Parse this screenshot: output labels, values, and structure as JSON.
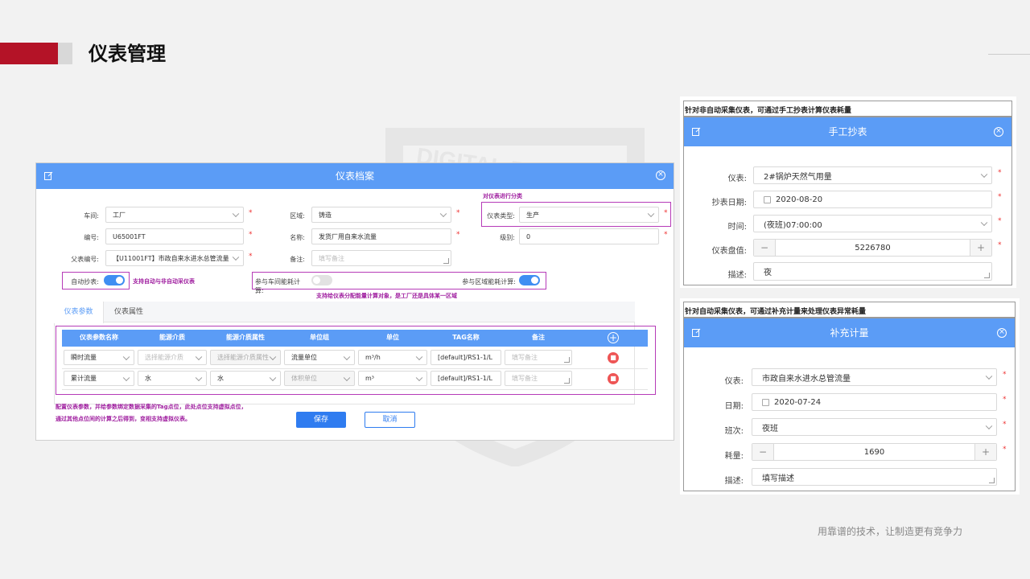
{
  "page": {
    "title": "仪表管理",
    "footer": "用靠谱的技术，让制造更有竞争力"
  },
  "watermark": {
    "text": "DIGITAL FACTORY"
  },
  "colors": {
    "accent": "#5b9cf6",
    "brand_red": "#b41327",
    "annotation": "#a020a0"
  },
  "meter_dialog": {
    "title": "仪表档案",
    "annotation_classify": "对仪表进行分类",
    "fields": {
      "workshop_label": "车间:",
      "workshop_value": "工厂",
      "area_label": "区域:",
      "area_value": "铸造",
      "type_label": "仪表类型:",
      "type_value": "生产",
      "code_label": "编号:",
      "code_value": "U65001FT",
      "name_label": "名称:",
      "name_value": "发货厂用自来水流量",
      "level_label": "级别:",
      "level_value": "0",
      "parent_label": "父表编号:",
      "parent_value": "【U11001FT】市政自来水进水总管流量",
      "remark_label": "备注:",
      "remark_placeholder": "填写备注"
    },
    "toggles": {
      "auto_read_label": "自动抄表:",
      "auto_read_note": "支持自动与非自动采仪表",
      "workshop_calc_label": "参与车间能耗计算:",
      "area_calc_label": "参与区域能耗计算:",
      "calc_note": "支持给仪表分配能量计算对象，是工厂还是具体某一区域"
    },
    "tabs": [
      "仪表参数",
      "仪表属性"
    ],
    "table": {
      "headers": [
        "仪表参数名称",
        "能源介质",
        "能源介质属性",
        "单位组",
        "单位",
        "TAG名称",
        "备注"
      ],
      "rows": [
        {
          "name": "瞬时流量",
          "medium": "选择能源介质",
          "medium_attr": "选择能源介质属性",
          "unit_group": "流量单位",
          "unit": "m³/h",
          "tag": "[default]/RS1-1/L",
          "remark": "填写备注"
        },
        {
          "name": "累计流量",
          "medium": "水",
          "medium_attr": "水",
          "unit_group": "体积单位",
          "unit": "m³",
          "tag": "[default]/RS1-1/L",
          "remark": "填写备注"
        }
      ]
    },
    "table_note_1": "配置仪表参数，并给参数绑定数据采集的Tag点位，此处点位支持虚拟点位，",
    "table_note_2": "通过其他点位间的计算之后得到，变相支持虚拟仪表。",
    "save_label": "保存",
    "cancel_label": "取消"
  },
  "manual_panel": {
    "caption": "针对非自动采集仪表，可通过手工抄表计算仪表耗量",
    "title": "手工抄表",
    "meter_label": "仪表:",
    "meter_value": "2#锅炉天然气用量",
    "date_label": "抄表日期:",
    "date_value": "2020-08-20",
    "time_label": "时间:",
    "time_value": "(夜班)07:00:00",
    "reading_label": "仪表盘值:",
    "reading_value": "5226780",
    "desc_label": "描述:",
    "desc_value": "夜"
  },
  "supplement_panel": {
    "caption": "针对自动采集仪表，可通过补充计量来处理仪表异常耗量",
    "title": "补充计量",
    "meter_label": "仪表:",
    "meter_value": "市政自来水进水总管流量",
    "date_label": "日期:",
    "date_value": "2020-07-24",
    "shift_label": "班次:",
    "shift_value": "夜班",
    "amount_label": "耗量:",
    "amount_value": "1690",
    "desc_label": "描述:",
    "desc_placeholder": "填写描述"
  }
}
